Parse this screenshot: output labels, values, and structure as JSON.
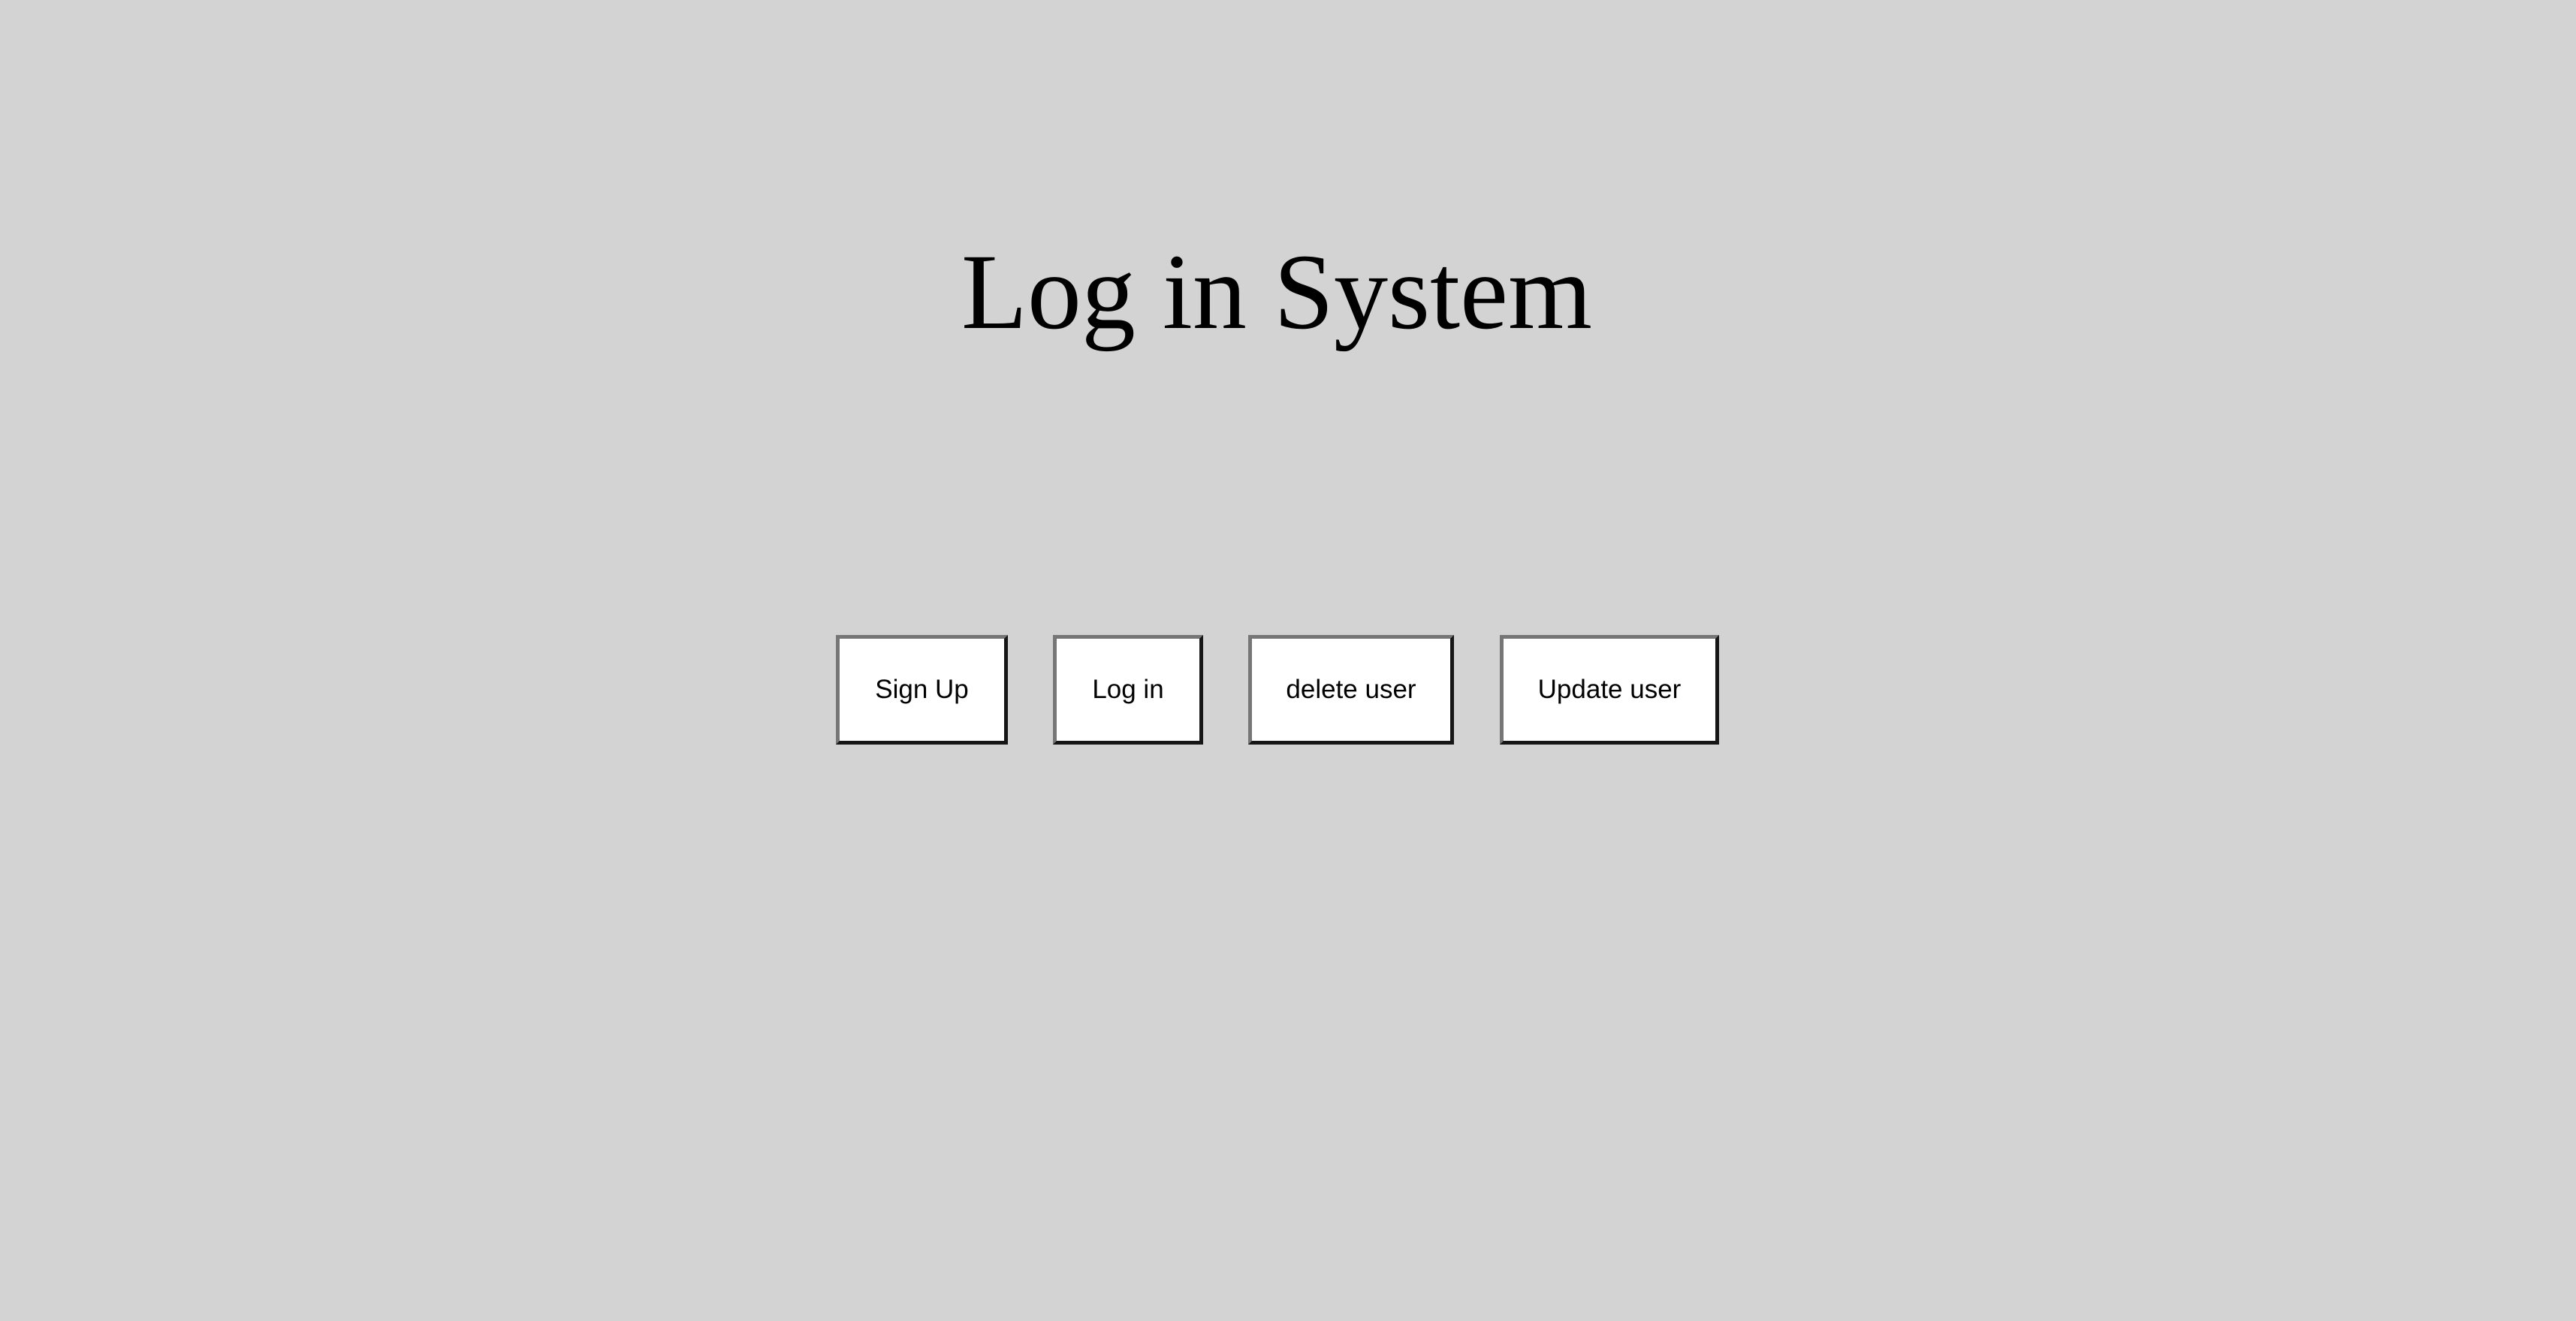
{
  "page": {
    "title": "Log in System",
    "background_color": "#d3d3d3"
  },
  "actions": {
    "sign_up_label": "Sign Up",
    "log_in_label": "Log in",
    "delete_user_label": "delete user",
    "update_user_label": "Update user"
  }
}
